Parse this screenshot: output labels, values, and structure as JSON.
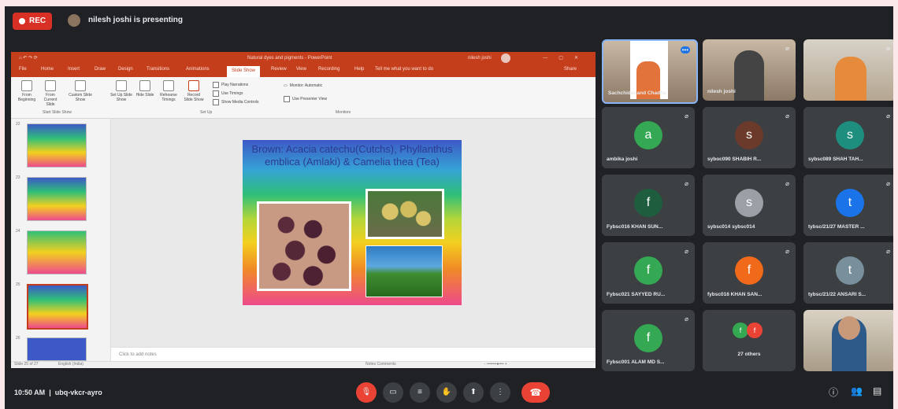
{
  "meet": {
    "rec_label": "REC",
    "presenting_text": "nilesh joshi is presenting",
    "time": "10:50 AM",
    "meeting_code": "ubq-vkcr-ayro",
    "colors": {
      "bg": "#202124",
      "tile": "#3c4043",
      "end_call": "#ea4335"
    }
  },
  "ppt": {
    "title_doc": "Natural dyes and pigments - PowerPoint",
    "title_user": "nilesh joshi",
    "tabs": [
      "File",
      "Home",
      "Insert",
      "Draw",
      "Design",
      "Transitions",
      "Animations",
      "Slide Show",
      "Review",
      "View",
      "Recording",
      "Help",
      "Tell me what you want to do"
    ],
    "share_label": "Share",
    "ribbon": {
      "buttons": [
        "From Beginning",
        "From Current Slide",
        "Custom Slide Show",
        "Set Up Slide Show",
        "Hide Slide",
        "Rehearse Timings",
        "Record Slide Show"
      ],
      "checks": [
        "Play Narrations",
        "Use Timings",
        "Show Media Controls"
      ],
      "monitor_label": "Monitor: Automatic",
      "presenter_view": "Use Presenter View",
      "groups": [
        "Start Slide Show",
        "Set Up",
        "Monitors"
      ]
    },
    "thumb_numbers": [
      "22",
      "23",
      "24",
      "25",
      "26"
    ],
    "slide_title": "Brown: Acacia catechu(Cutchs), Phyllanthus emblica (Amlaki) & Camelia thea (Tea)",
    "notes_placeholder": "Click to add notes",
    "status_left": "Slide 25 of 27",
    "status_lang": "English (India)",
    "status_right": "Notes   Comments"
  },
  "participants": [
    {
      "name": "Sachchidanand Chadha",
      "type": "camera",
      "self": true
    },
    {
      "name": "nilesh joshi",
      "type": "camera"
    },
    {
      "name": "",
      "type": "camera"
    },
    {
      "name": "ambika joshi",
      "initial": "a",
      "color": "#34a853"
    },
    {
      "name": "syboc090 SHABIH R...",
      "initial": "s",
      "color": "#6b3a2a"
    },
    {
      "name": "sybsc089 SHAH TAH...",
      "initial": "s",
      "color": "#1e8e7e"
    },
    {
      "name": "Fybsc016 KHAN SUN...",
      "initial": "f",
      "color": "#1e5e3e"
    },
    {
      "name": "sybsc014 sybsc014",
      "initial": "s",
      "color": "#9aa0a6"
    },
    {
      "name": "tybsc/21/27 MASTER ...",
      "initial": "t",
      "color": "#1a73e8"
    },
    {
      "name": "Fybsc021 SAYYED RU...",
      "initial": "f",
      "color": "#34a853"
    },
    {
      "name": "fybsc016 KHAN SAN...",
      "initial": "f",
      "color": "#f06a1a"
    },
    {
      "name": "tybsc/21/22 ANSARI S...",
      "initial": "t",
      "color": "#78909c"
    },
    {
      "name": "Fybsc001 ALAM MD S...",
      "initial": "f",
      "color": "#34a853"
    },
    {
      "name": "27 others",
      "initial": "",
      "color": ""
    },
    {
      "name": "",
      "type": "camera"
    }
  ],
  "icons": [
    "mic-off-icon",
    "camera-icon",
    "captions-icon",
    "raise-hand-icon",
    "present-icon",
    "more-icon",
    "end-call-icon",
    "info-icon",
    "people-icon",
    "chat-icon"
  ]
}
